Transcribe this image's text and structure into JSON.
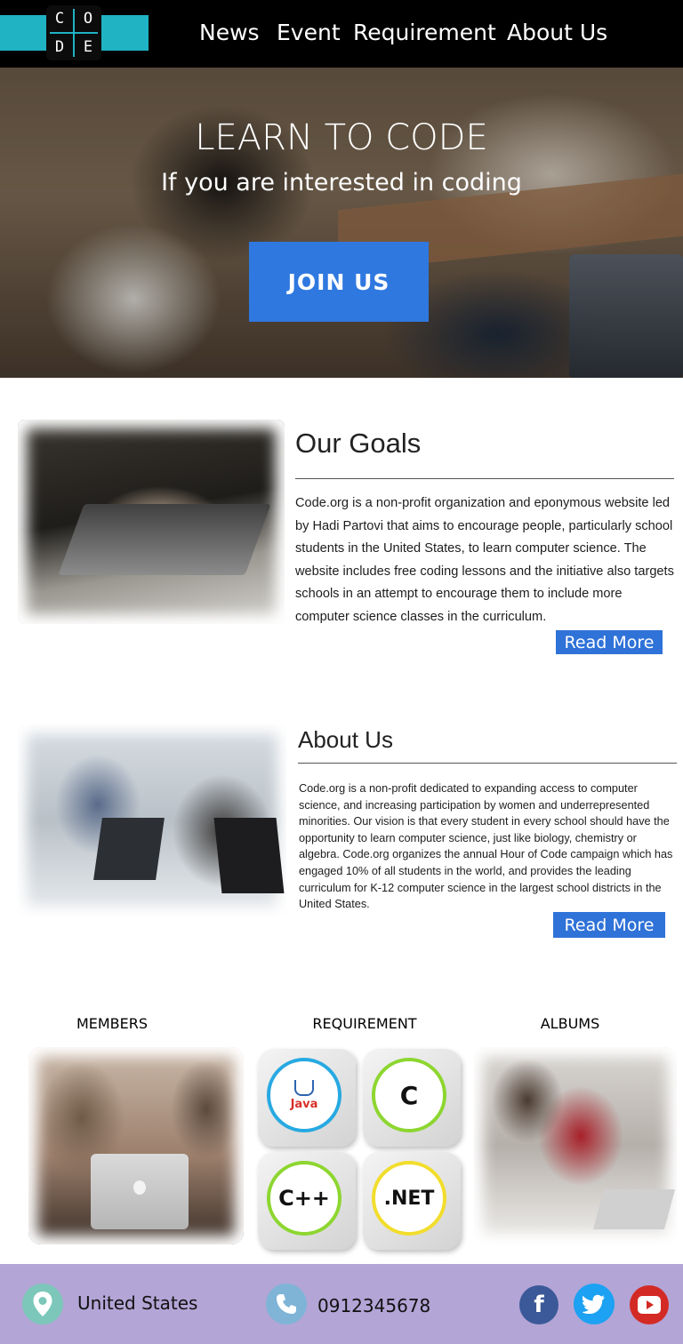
{
  "header": {
    "logo": {
      "letters": [
        "C",
        "O",
        "D",
        "E"
      ]
    },
    "nav": [
      {
        "label": "News"
      },
      {
        "label": "Event"
      },
      {
        "label": "Requirement"
      },
      {
        "label": "About Us"
      }
    ]
  },
  "hero": {
    "title": "LEARN TO CODE",
    "subtitle": "If you are interested in coding",
    "cta_label": "JOIN US",
    "cta_color": "#2f78e0"
  },
  "goals": {
    "title": "Our Goals",
    "body": "Code.org is a non-profit organization and eponymous website led by Hadi Partovi that aims to encourage people, particularly school students in the United States, to learn computer science. The website includes free coding lessons and the initiative also targets schools in an attempt to encourage them to include more computer science classes in the curriculum.",
    "read_more": "Read More"
  },
  "about": {
    "title": "About Us",
    "body": "Code.org is a non-profit dedicated to expanding access to computer science, and increasing participation by women and underrepresented minorities. Our vision is that every student in every school should have the opportunity to learn computer science, just like biology, chemistry or algebra. Code.org organizes the annual Hour of Code campaign which has engaged 10% of all students in the world, and provides the leading curriculum for K-12 computer science in the largest school districts in the United States.",
    "read_more": "Read More"
  },
  "categories": {
    "members": "MEMBERS",
    "requirement": "REQUIREMENT",
    "albums": "ALBUMS",
    "languages": [
      {
        "name": "Java",
        "ring_color": "#27a9e1"
      },
      {
        "name": "C",
        "ring_color": "#8dd630"
      },
      {
        "name": "C++",
        "ring_color": "#8dd630"
      },
      {
        "name": ".NET",
        "ring_color": "#f2dd2c"
      }
    ]
  },
  "footer": {
    "location": "United States",
    "phone": "0912345678",
    "icons": {
      "location": "map-pin-icon",
      "phone": "phone-icon"
    },
    "social": [
      {
        "name": "facebook-icon",
        "color": "#3b5998"
      },
      {
        "name": "twitter-icon",
        "color": "#1da1f2"
      },
      {
        "name": "youtube-icon",
        "color": "#d32a25"
      }
    ]
  },
  "colors": {
    "header_bg": "#000000",
    "accent_cyan": "#1fb3c4",
    "button_blue": "#2f72d8",
    "footer_bg": "#b3a5d6"
  }
}
